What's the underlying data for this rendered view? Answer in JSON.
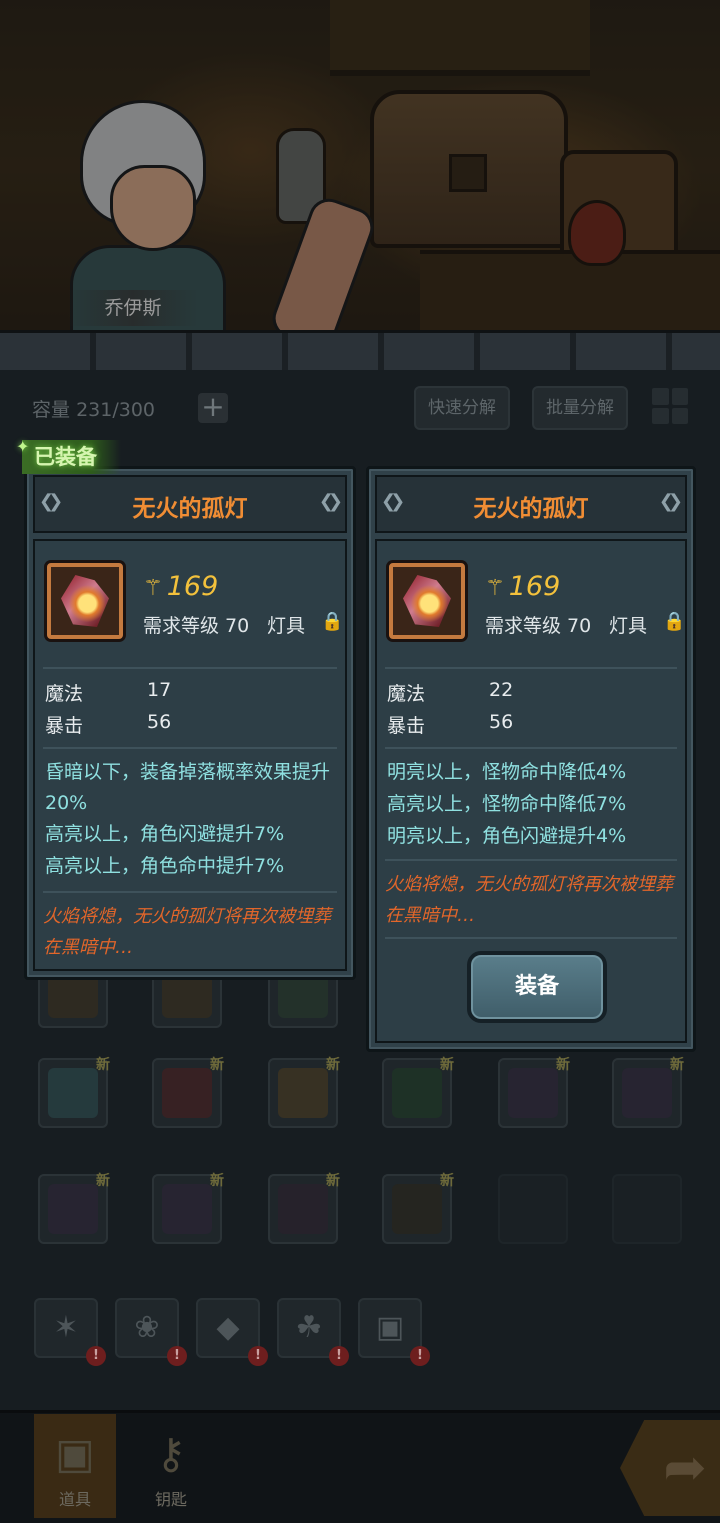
{
  "hero": {
    "name": "乔伊斯"
  },
  "bag": {
    "capacity_label": "容量",
    "capacity_value": "231/300",
    "quick_disassemble": "快速分解",
    "batch_disassemble": "批量分解",
    "new_badge": "新"
  },
  "equipped_tag": "已装备",
  "cards": {
    "equipped": {
      "title": "无火的孤灯",
      "score": "169",
      "req_level": "需求等级 70",
      "type": "灯具",
      "stats": [
        {
          "name": "魔法",
          "value": "17"
        },
        {
          "name": "暴击",
          "value": "56"
        }
      ],
      "effects": [
        "昏暗以下，装备掉落概率效果提升20%",
        "高亮以上，角色闪避提升7%",
        "高亮以上，角色命中提升7%"
      ],
      "flavor": "火焰将熄，无火的孤灯将再次被埋葬在黑暗中…"
    },
    "candidate": {
      "title": "无火的孤灯",
      "score": "169",
      "req_level": "需求等级 70",
      "type": "灯具",
      "stats": [
        {
          "name": "魔法",
          "value": "22"
        },
        {
          "name": "暴击",
          "value": "56"
        }
      ],
      "effects": [
        "明亮以上，怪物命中降低4%",
        "高亮以上，怪物命中降低7%",
        "明亮以上，角色闪避提升4%"
      ],
      "flavor": "火焰将熄，无火的孤灯将再次被埋葬在黑暗中…",
      "equip_button": "装备"
    }
  },
  "bottom_nav": {
    "tabs": [
      {
        "label": "道具",
        "icon": "chest-icon",
        "active": true
      },
      {
        "label": "钥匙",
        "icon": "key-icon",
        "active": false
      }
    ],
    "next_icon": "arrow-right-icon"
  },
  "colors": {
    "title_orange": "#f08d34",
    "score_gold": "#f3c13c",
    "effect_cyan": "#8fe0e0",
    "flavor_orange": "#e2662a",
    "equipped_green": "#3b6d25"
  }
}
